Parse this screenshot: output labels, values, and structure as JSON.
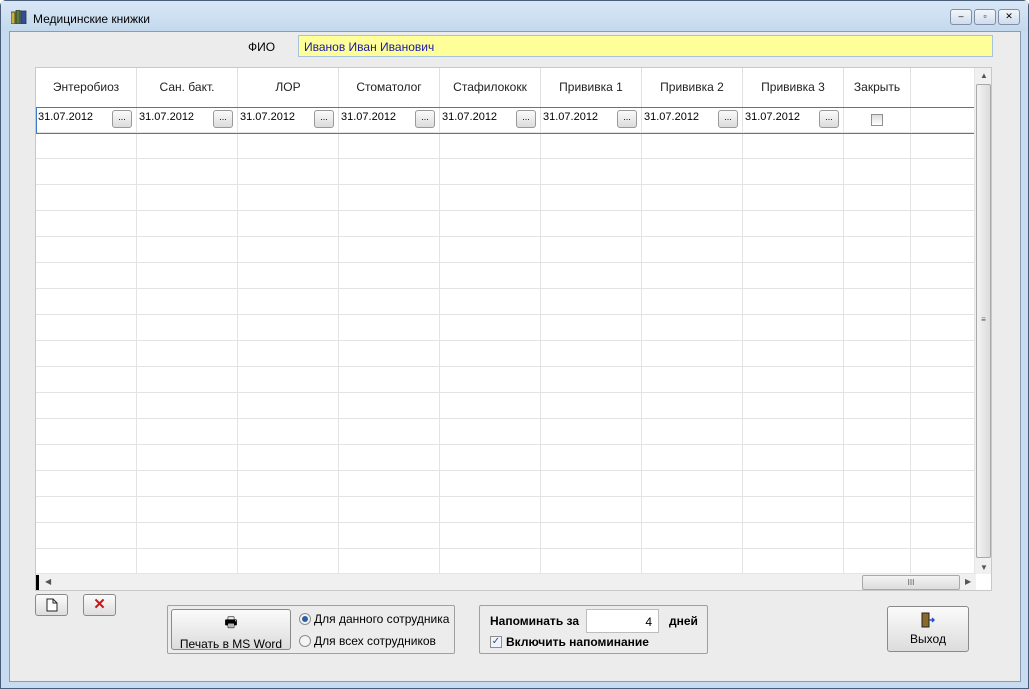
{
  "window": {
    "title": "Медицинские книжки",
    "minimize": "–",
    "restore": "▫",
    "close": "✕"
  },
  "fio": {
    "label": "ФИО",
    "value": "Иванов Иван Иванович"
  },
  "table": {
    "columns": [
      "Энтеробиоз",
      "Сан. бакт.",
      "ЛОР",
      "Стоматолог",
      "Стафилококк",
      "Прививка 1",
      "Прививка 2",
      "Прививка 3",
      "Закрыть"
    ],
    "rows": [
      {
        "dates": [
          "31.07.2012",
          "31.07.2012",
          "31.07.2012",
          "31.07.2012",
          "31.07.2012",
          "31.07.2012",
          "31.07.2012",
          "31.07.2012"
        ],
        "close": false
      }
    ],
    "dots_label": "..."
  },
  "toolbar": {
    "new_icon": "document-icon",
    "delete_label": "✕"
  },
  "print": {
    "button_label": "Печать в MS Word",
    "option_current": "Для данного сотрудника",
    "option_all": "Для всех сотрудников",
    "selected": "current"
  },
  "reminder": {
    "label": "Напоминать за",
    "days_value": "4",
    "days_label": "дней",
    "enable_label": "Включить напоминание",
    "enabled": true
  },
  "exit": {
    "label": "Выход"
  }
}
